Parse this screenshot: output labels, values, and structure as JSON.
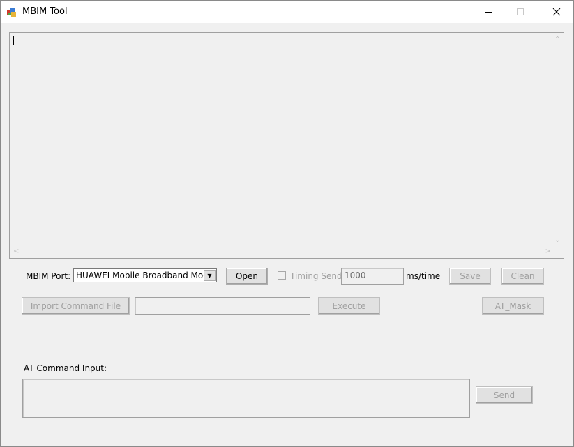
{
  "window": {
    "title": "MBIM Tool"
  },
  "log_area": {
    "content": ""
  },
  "port": {
    "label": "MBIM Port:",
    "selected": "HUAWEI Mobile Broadband Module",
    "open_label": "Open"
  },
  "timing": {
    "checkbox_label": "Timing Send",
    "checked": false,
    "interval_value": "1000",
    "unit_label": "ms/time"
  },
  "toolbar": {
    "save_label": "Save",
    "clean_label": "Clean",
    "import_label": "Import Command File",
    "file_path": "",
    "execute_label": "Execute",
    "at_mask_label": "AT_Mask"
  },
  "at_input": {
    "label": "AT Command Input:",
    "value": "",
    "send_label": "Send"
  }
}
